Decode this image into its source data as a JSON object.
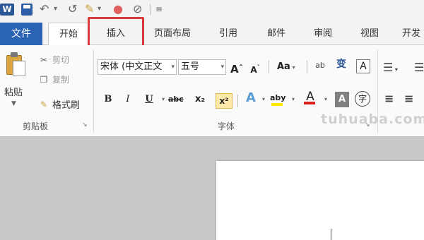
{
  "app": {
    "logo_letter": "W"
  },
  "qat": {
    "undo_glyph": "↶",
    "redo_glyph": "↺",
    "customize_glyph": "▾",
    "more_glyph": "≡"
  },
  "tabs": {
    "file": "文件",
    "items": [
      "开始",
      "插入",
      "页面布局",
      "引用",
      "邮件",
      "审阅",
      "视图",
      "开发"
    ],
    "active": "开始",
    "highlighted": "插入",
    "highlight_color": "#d83b3b"
  },
  "clipboard": {
    "paste_label": "粘贴",
    "cut_label": "剪切",
    "copy_label": "复制",
    "format_painter_label": "格式刷",
    "group_label": "剪贴板"
  },
  "font": {
    "font_name": "宋体 (中文正文",
    "font_size": "五号",
    "grow_label": "A",
    "shrink_label": "A",
    "case_label": "Aa",
    "phonetic_label": "ab",
    "bold": "B",
    "italic": "I",
    "underline": "U",
    "strike": "abc",
    "subscript": "x₂",
    "superscript": "x²",
    "group_label": "字体",
    "text_effect": "A",
    "highlight_label": "aby",
    "font_color_label": "A",
    "char_shading_label": "A",
    "enclose_label": "字",
    "border_label": "A"
  },
  "paragraph": {
    "list_glyph": "☰",
    "align_glyph": "≡"
  },
  "colors": {
    "file_tab": "#2b63b4",
    "accent_red": "#d83b3b",
    "highlight_yellow": "#ffe600",
    "font_red": "#e02020"
  },
  "watermark": "tuhuaba.com"
}
